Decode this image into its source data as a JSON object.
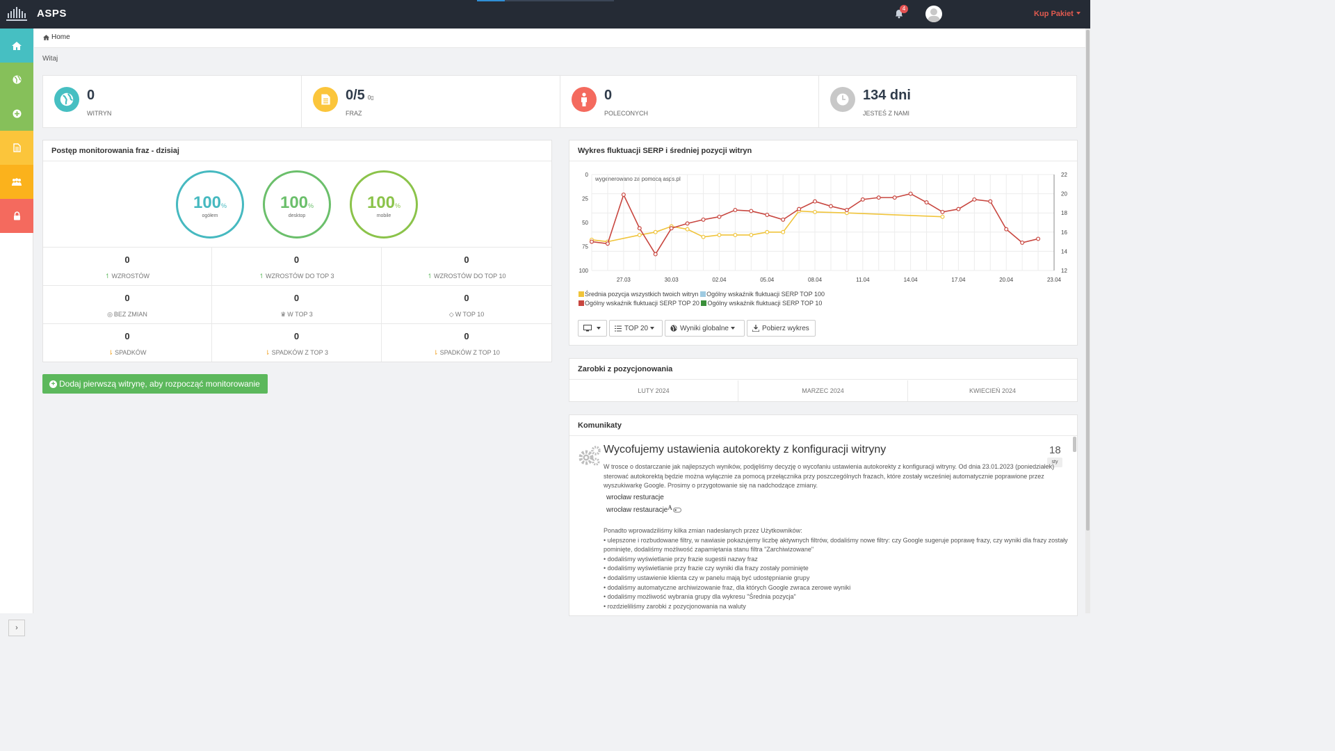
{
  "app": {
    "name": "ASPS"
  },
  "topbar": {
    "notifications_count": "4",
    "buy_label": "Kup Pakiet"
  },
  "sidebar": {
    "items": [
      {
        "name": "home",
        "icon": "home-icon",
        "color": "#46bfc2"
      },
      {
        "name": "globe",
        "icon": "globe-icon",
        "color": "#86c05a"
      },
      {
        "name": "add",
        "icon": "plus-circle-icon",
        "color": "#86c05a"
      },
      {
        "name": "document",
        "icon": "document-icon",
        "color": "#fbc53b"
      },
      {
        "name": "users",
        "icon": "users-icon",
        "color": "#fbb21c"
      },
      {
        "name": "lock",
        "icon": "lock-icon",
        "color": "#f46a5e"
      }
    ],
    "toggle": "›"
  },
  "breadcrumb": {
    "home": "Home"
  },
  "welcome": "Witaj",
  "stats": [
    {
      "value": "0",
      "label": "WITRYN",
      "icon": "globe-icon",
      "color": "#46bfc2"
    },
    {
      "value": "0/5",
      "sub": "0",
      "label": "FRAZ",
      "icon": "document-icon",
      "color": "#fbc53b"
    },
    {
      "value": "0",
      "label": "POLECONYCH",
      "icon": "person-icon",
      "color": "#f46a5e"
    },
    {
      "value": "134 dni",
      "label": "JESTEŚ Z NAMI",
      "icon": "clock-icon",
      "color": "#c8c8c8"
    }
  ],
  "progress": {
    "title": "Postęp monitorowania fraz - dzisiaj",
    "rings": [
      {
        "value": "100",
        "unit": "%",
        "label": "ogółem",
        "color": "#46b9c0"
      },
      {
        "value": "100",
        "unit": "%",
        "label": "desktop",
        "color": "#6bbf6b"
      },
      {
        "value": "100",
        "unit": "%",
        "label": "mobile",
        "color": "#8bc34a"
      }
    ],
    "cells": [
      {
        "value": "0",
        "label": "WZROSTÓW",
        "icon": "arrow-up-icon"
      },
      {
        "value": "0",
        "label": "WZROSTÓW DO TOP 3",
        "icon": "arrow-up-icon"
      },
      {
        "value": "0",
        "label": "WZROSTÓW DO TOP 10",
        "icon": "arrow-up-icon"
      },
      {
        "value": "0",
        "label": "BEZ ZMIAN",
        "icon": "circle-icon"
      },
      {
        "value": "0",
        "label": "W TOP 3",
        "icon": "trophy-icon"
      },
      {
        "value": "0",
        "label": "W TOP 10",
        "icon": "diamond-icon"
      },
      {
        "value": "0",
        "label": "SPADKÓW",
        "icon": "arrow-down-icon"
      },
      {
        "value": "0",
        "label": "SPADKÓW Z TOP 3",
        "icon": "arrow-down-icon"
      },
      {
        "value": "0",
        "label": "SPADKÓW Z TOP 10",
        "icon": "arrow-down-icon"
      }
    ],
    "add_button": "Dodaj pierwszą witrynę, aby rozpocząć monitorowanie"
  },
  "serp": {
    "title": "Wykres fluktuacji SERP i średniej pozycji witryn",
    "watermark": "wygenerowano za pomocą asps.pl",
    "controls": {
      "device_icon": "desktop-icon",
      "top": "TOP 20",
      "scope": "Wyniki globalne",
      "download": "Pobierz wykres"
    }
  },
  "chart_data": {
    "type": "line",
    "x": [
      "25.03",
      "26.03",
      "27.03",
      "28.03",
      "29.03",
      "30.03",
      "31.03",
      "01.04",
      "02.04",
      "03.04",
      "04.04",
      "05.04",
      "06.04",
      "07.04",
      "08.04",
      "09.04",
      "10.04",
      "11.04",
      "12.04",
      "13.04",
      "14.04",
      "15.04",
      "16.04",
      "17.04",
      "18.04",
      "19.04",
      "20.04",
      "21.04",
      "22.04",
      "23.04"
    ],
    "x_tick_labels": [
      "27.03",
      "30.03",
      "02.04",
      "05.04",
      "08.04",
      "11.04",
      "14.04",
      "17.04",
      "20.04",
      "23.04"
    ],
    "y_left": {
      "ticks": [
        0,
        25,
        50,
        75,
        100
      ],
      "reversed": true,
      "range": [
        0,
        100
      ]
    },
    "y_right": {
      "ticks": [
        12,
        14,
        16,
        18,
        20,
        22
      ],
      "range": [
        12,
        22
      ]
    },
    "series": [
      {
        "name": "Średnia pozycja wszystkich twoich witryn",
        "color": "#f0c43a",
        "axis": "left",
        "values": [
          68,
          70,
          null,
          63,
          60,
          54,
          57,
          65,
          63,
          63,
          63,
          60,
          60,
          38,
          39,
          null,
          40,
          null,
          null,
          null,
          null,
          null,
          44,
          null,
          null,
          null,
          null,
          null,
          null,
          null
        ]
      },
      {
        "name": "Ogólny wskaźnik fluktuacji SERP TOP 100",
        "color": "#9ecae1",
        "axis": "right",
        "values": []
      },
      {
        "name": "Ogólny wskaźnik fluktuacji SERP TOP 20",
        "color": "#c8463f",
        "axis": "right",
        "values": [
          15.0,
          14.8,
          19.9,
          16.4,
          13.7,
          16.4,
          16.9,
          17.3,
          17.6,
          18.3,
          18.2,
          17.8,
          17.3,
          18.4,
          19.2,
          18.7,
          18.3,
          19.4,
          19.6,
          19.6,
          20.0,
          19.1,
          18.1,
          18.4,
          19.4,
          19.2,
          16.3,
          14.9,
          15.3,
          null
        ]
      },
      {
        "name": "Ogólny wskaźnik fluktuacji SERP TOP 10",
        "color": "#3a8f3a",
        "axis": "right",
        "values": []
      }
    ]
  },
  "earnings": {
    "title": "Zarobki z pozycjonowania",
    "months": [
      "LUTY 2024",
      "MARZEC 2024",
      "KWIECIEŃ 2024"
    ]
  },
  "news": {
    "title": "Komunikaty",
    "item_title": "Wycofujemy ustawienia autokorekty z konfiguracji witryny",
    "day": "18",
    "month": "sty",
    "body": "W trosce o dostarczanie jak najlepszych wyników, podjęliśmy decyzję o wycofaniu ustawienia autokorekty z konfiguracji witryny. Od dnia 23.01.2023 (poniedziałek) sterować autokorektą będzie można wyłącznie za pomocą przełącznika przy poszczególnych frazach, które zostały wcześniej automatycznie poprawione przez wyszukiwarkę Google. Prosimy o przygotowanie się na nadchodzące zmiany.",
    "phrase1": "wrocław resturacje",
    "phrase2": "wrocław restauracje",
    "intro": "Ponadto wprowadziliśmy kilka zmian nadesłanych przez Użytkowników:",
    "bullets": [
      "• ulepszone i rozbudowane filtry, w nawiasie pokazujemy liczbę aktywnych filtrów, dodaliśmy nowe filtry: czy Google sugeruje poprawę frazy, czy wyniki dla frazy zostały pominięte, dodaliśmy możliwość zapamiętania stanu filtra \"Zarchiwizowane\"",
      "• dodaliśmy wyświetlanie przy frazie sugestii nazwy fraz",
      "• dodaliśmy wyświetlanie przy frazie czy wyniki dla frazy zostały pominięte",
      "• dodaliśmy ustawienie klienta czy w panelu mają być udostępnianie grupy",
      "• dodaliśmy automatyczne archiwizowanie fraz, dla których Google zwraca zerowe wyniki",
      "• dodaliśmy możliwość wybrania grupy dla wykresu \"Średnia pozycja\"",
      "• rozdzieliliśmy zarobki z pozycjonowania na waluty"
    ]
  }
}
